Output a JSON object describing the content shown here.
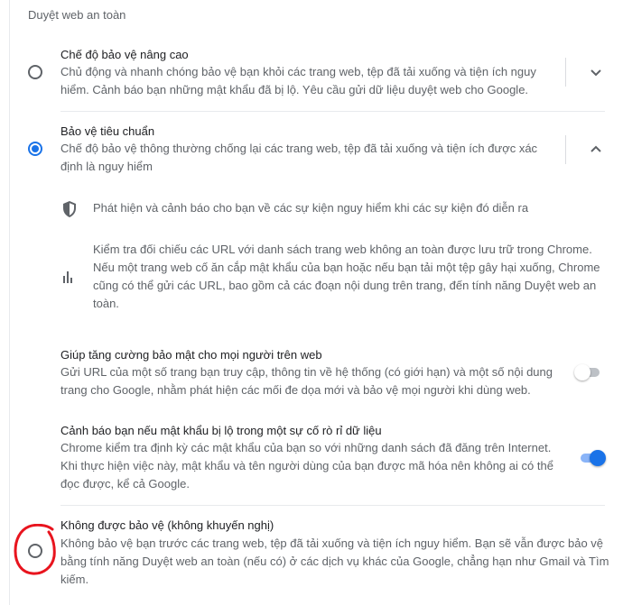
{
  "section_title": "Duyệt web an toàn",
  "enhanced": {
    "title": "Chế độ bảo vệ nâng cao",
    "desc_line1": "Chủ động và nhanh chóng bảo vệ bạn khỏi các trang web, tệp đã tải xuống và tiện ích nguy",
    "desc_line2": "hiểm. Cảnh báo bạn những mật khẩu đã bị lộ. Yêu cầu gửi dữ liệu duyệt web cho Google.",
    "selected": false,
    "expand_icon": "chevron-down-icon"
  },
  "standard": {
    "title": "Bảo vệ tiêu chuẩn",
    "desc_line1": "Chế độ bảo vệ thông thường chống lại các trang web, tệp đã tải xuống và tiện ích được xác",
    "desc_line2": "định là nguy hiểm",
    "selected": true,
    "expand_icon": "chevron-up-icon",
    "details": [
      {
        "icon": "shield-icon",
        "lines": [
          "Phát hiện và cảnh báo cho bạn về các sự kiện nguy hiểm khi các sự kiện đó diễn ra"
        ]
      },
      {
        "icon": "bar-chart-icon",
        "lines": [
          "Kiểm tra đối chiếu các URL với danh sách trang web không an toàn được lưu trữ trong Chrome.",
          "Nếu một trang web cố ăn cắp mật khẩu của bạn hoặc nếu bạn tải một tệp gây hại xuống, Chrome",
          "cũng có thể gửi các URL, bao gồm cả các đoạn nội dung trên trang, đến tính năng Duyệt web an",
          "toàn."
        ]
      }
    ],
    "help_improve": {
      "title": "Giúp tăng cường bảo mật cho mọi người trên web",
      "desc_line1": "Gửi URL của một số trang bạn truy cập, thông tin về hệ thống (có giới hạn) và một số nội dung",
      "desc_line2": "trang cho Google, nhằm phát hiện các mối đe dọa mới và bảo vệ mọi người khi dùng web.",
      "enabled": false
    },
    "password_leak": {
      "title": "Cảnh báo bạn nếu mật khẩu bị lộ trong một sự cố rò rỉ dữ liệu",
      "desc_line1": "Chrome kiểm tra định kỳ các mật khẩu của bạn so với những danh sách đã đăng trên Internet.",
      "desc_line2": "Khi thực hiện việc này, mật khẩu và tên người dùng của bạn được mã hóa nên không ai có thể",
      "desc_line3": "đọc được, kể cả Google.",
      "enabled": true
    }
  },
  "no_protection": {
    "title": "Không được bảo vệ (không khuyến nghị)",
    "desc_line1": "Không bảo vệ bạn trước các trang web, tệp đã tải xuống và tiện ích nguy hiểm. Bạn sẽ vẫn được bảo vệ",
    "desc_line2": "bằng tính năng Duyệt web an toàn (nếu có) ở các dịch vụ khác của Google, chẳng hạn như Gmail và Tìm",
    "desc_line3": "kiếm.",
    "selected": false
  },
  "colors": {
    "accent": "#1a73e8",
    "annotation": "#e8141e",
    "secondary_text": "#5f6368"
  }
}
